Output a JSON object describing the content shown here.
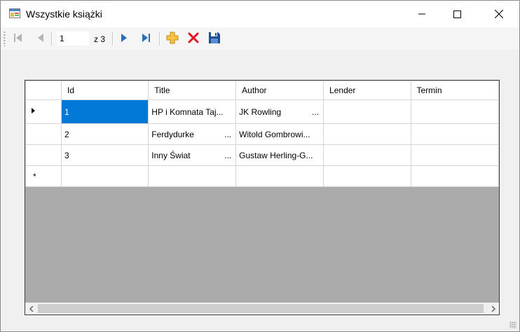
{
  "window": {
    "title": "Wszystkie książki"
  },
  "navigator": {
    "position": "1",
    "count_label": "z 3"
  },
  "grid": {
    "columns": [
      "Id",
      "Title",
      "Author",
      "Lender",
      "Termin"
    ],
    "rows": [
      {
        "id": "1",
        "title": "HP i Komnata Taj...",
        "author": "JK Rowling",
        "lender": "",
        "termin": ""
      },
      {
        "id": "2",
        "title": "Ferdydurke",
        "author": "Witold Gombrowi...",
        "lender": "",
        "termin": ""
      },
      {
        "id": "3",
        "title": "Inny Świat",
        "author": "Gustaw Herling-G...",
        "lender": "",
        "termin": ""
      }
    ],
    "new_row_marker": "*"
  },
  "colors": {
    "selection": "#0078d7",
    "nav_blue": "#2a6ebb",
    "delete_red": "#e81123",
    "add_orange": "#f5a623",
    "empty_area": "#ababab"
  }
}
